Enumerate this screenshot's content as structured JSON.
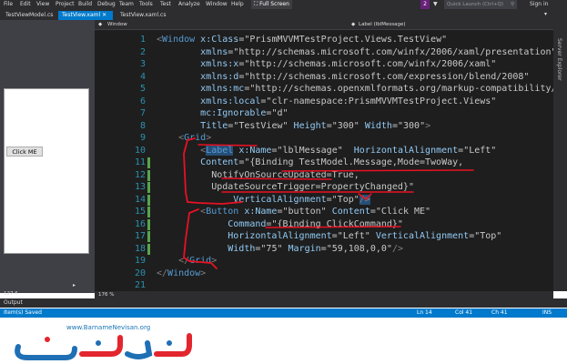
{
  "menubar": {
    "items": [
      "File",
      "Edit",
      "View",
      "Project",
      "Build",
      "Debug",
      "Team",
      "Tools",
      "Test",
      "Analyze",
      "Window",
      "Help"
    ],
    "fullscreen_label": "Full Screen",
    "notification_count": "2",
    "search_placeholder": "Quick Launch (Ctrl+Q)",
    "signin_label": "Sign in"
  },
  "tabs": [
    {
      "label": "TestViewModel.cs",
      "active": false
    },
    {
      "label": "TestView.xaml",
      "active": true
    },
    {
      "label": "TestView.xaml.cs",
      "active": false
    }
  ],
  "designer": {
    "button_label": "Click ME"
  },
  "editor_header": {
    "left": "Window",
    "right": "Label (lblMessage)"
  },
  "server_panel": {
    "label": "Server Explorer"
  },
  "code_lines": [
    {
      "num": "1",
      "marked": false,
      "tokens": [
        {
          "t": "<",
          "c": "d"
        },
        {
          "t": "Window",
          "c": "e"
        },
        {
          "t": " x:Class",
          "c": "a"
        },
        {
          "t": "=",
          "c": "b"
        },
        {
          "t": "\"PrismMVVMTestProject.Views.TestView\"",
          "c": "v"
        }
      ]
    },
    {
      "num": "2",
      "marked": false,
      "tokens": [
        {
          "t": "        xmlns",
          "c": "a"
        },
        {
          "t": "=",
          "c": "b"
        },
        {
          "t": "\"http://schemas.microsoft.com/winfx/2006/xaml/presentation\"",
          "c": "v"
        }
      ]
    },
    {
      "num": "3",
      "marked": false,
      "tokens": [
        {
          "t": "        xmlns:x",
          "c": "a"
        },
        {
          "t": "=",
          "c": "b"
        },
        {
          "t": "\"http://schemas.microsoft.com/winfx/2006/xaml\"",
          "c": "v"
        }
      ]
    },
    {
      "num": "4",
      "marked": false,
      "tokens": [
        {
          "t": "        xmlns:d",
          "c": "a"
        },
        {
          "t": "=",
          "c": "b"
        },
        {
          "t": "\"http://schemas.microsoft.com/expression/blend/2008\"",
          "c": "v"
        }
      ]
    },
    {
      "num": "5",
      "marked": false,
      "tokens": [
        {
          "t": "        xmlns:mc",
          "c": "a"
        },
        {
          "t": "=",
          "c": "b"
        },
        {
          "t": "\"http://schemas.openxmlformats.org/markup-compatibility/20",
          "c": "v"
        }
      ]
    },
    {
      "num": "6",
      "marked": false,
      "tokens": [
        {
          "t": "        xmlns:local",
          "c": "a"
        },
        {
          "t": "=",
          "c": "b"
        },
        {
          "t": "\"clr-namespace:PrismMVVMTestProject.Views\"",
          "c": "v"
        }
      ]
    },
    {
      "num": "7",
      "marked": false,
      "tokens": [
        {
          "t": "        mc:Ignorable",
          "c": "a"
        },
        {
          "t": "=",
          "c": "b"
        },
        {
          "t": "\"d\"",
          "c": "v"
        }
      ]
    },
    {
      "num": "8",
      "marked": false,
      "tokens": [
        {
          "t": "        Title",
          "c": "a"
        },
        {
          "t": "=",
          "c": "b"
        },
        {
          "t": "\"TestView\"",
          "c": "v"
        },
        {
          "t": " Height",
          "c": "a"
        },
        {
          "t": "=",
          "c": "b"
        },
        {
          "t": "\"300\"",
          "c": "v"
        },
        {
          "t": " Width",
          "c": "a"
        },
        {
          "t": "=",
          "c": "b"
        },
        {
          "t": "\"300\"",
          "c": "v"
        },
        {
          "t": ">",
          "c": "d"
        }
      ]
    },
    {
      "num": "9",
      "marked": false,
      "tokens": [
        {
          "t": "    <",
          "c": "d"
        },
        {
          "t": "Grid",
          "c": "e"
        },
        {
          "t": ">",
          "c": "d"
        }
      ]
    },
    {
      "num": "10",
      "marked": false,
      "tokens": [
        {
          "t": "        <",
          "c": "d"
        },
        {
          "t": "Label",
          "c": "e",
          "hl": true
        },
        {
          "t": " x:Name",
          "c": "a"
        },
        {
          "t": "=",
          "c": "b"
        },
        {
          "t": "\"lblMessage\"",
          "c": "v"
        },
        {
          "t": "  HorizontalAlignment",
          "c": "a"
        },
        {
          "t": "=",
          "c": "b"
        },
        {
          "t": "\"Left\"",
          "c": "v"
        }
      ]
    },
    {
      "num": "11",
      "marked": true,
      "tokens": [
        {
          "t": "        Content",
          "c": "a"
        },
        {
          "t": "=",
          "c": "b"
        },
        {
          "t": "\"{Binding TestModel.Message,Mode=TwoWay,",
          "c": "v"
        }
      ]
    },
    {
      "num": "12",
      "marked": true,
      "tokens": [
        {
          "t": "          NotifyOnSourceUpdated=True,",
          "c": "v"
        }
      ]
    },
    {
      "num": "13",
      "marked": true,
      "tokens": [
        {
          "t": "          UpdateSourceTrigger=PropertyChanged}\"",
          "c": "v"
        }
      ]
    },
    {
      "num": "14",
      "marked": true,
      "tokens": [
        {
          "t": "              VerticalAlignment",
          "c": "a"
        },
        {
          "t": "=",
          "c": "b"
        },
        {
          "t": "\"Top\"",
          "c": "v"
        },
        {
          "t": "/>",
          "c": "d",
          "hl": true
        }
      ]
    },
    {
      "num": "15",
      "marked": true,
      "tokens": [
        {
          "t": "        <",
          "c": "d"
        },
        {
          "t": "Button",
          "c": "e"
        },
        {
          "t": " x:Name",
          "c": "a"
        },
        {
          "t": "=",
          "c": "b"
        },
        {
          "t": "\"button\"",
          "c": "v"
        },
        {
          "t": " Content",
          "c": "a"
        },
        {
          "t": "=",
          "c": "b"
        },
        {
          "t": "\"Click ME\"",
          "c": "v"
        }
      ]
    },
    {
      "num": "16",
      "marked": true,
      "tokens": [
        {
          "t": "             Command",
          "c": "a"
        },
        {
          "t": "=",
          "c": "b"
        },
        {
          "t": "\"{Binding ClickCommand}\"",
          "c": "v"
        }
      ]
    },
    {
      "num": "17",
      "marked": true,
      "tokens": [
        {
          "t": "             HorizontalAlignment",
          "c": "a"
        },
        {
          "t": "=",
          "c": "b"
        },
        {
          "t": "\"Left\"",
          "c": "v"
        },
        {
          "t": " VerticalAlignment",
          "c": "a"
        },
        {
          "t": "=",
          "c": "b"
        },
        {
          "t": "\"Top\"",
          "c": "v"
        }
      ]
    },
    {
      "num": "18",
      "marked": true,
      "tokens": [
        {
          "t": "             Width",
          "c": "a"
        },
        {
          "t": "=",
          "c": "b"
        },
        {
          "t": "\"75\"",
          "c": "v"
        },
        {
          "t": " Margin",
          "c": "a"
        },
        {
          "t": "=",
          "c": "b"
        },
        {
          "t": "\"59,108,0,0\"",
          "c": "v"
        },
        {
          "t": "/>",
          "c": "d"
        }
      ]
    },
    {
      "num": "19",
      "marked": false,
      "tokens": [
        {
          "t": "    </",
          "c": "d"
        },
        {
          "t": "Grid",
          "c": "e"
        },
        {
          "t": ">",
          "c": "d"
        }
      ]
    },
    {
      "num": "20",
      "marked": false,
      "tokens": [
        {
          "t": "</",
          "c": "d"
        },
        {
          "t": "Window",
          "c": "e"
        },
        {
          "t": ">",
          "c": "d"
        }
      ]
    },
    {
      "num": "21",
      "marked": false,
      "tokens": []
    }
  ],
  "editor_status": {
    "left_zoom": "127.6",
    "zoom": "176 %"
  },
  "output_label": "Output",
  "statusbar": {
    "message": "Item(s) Saved",
    "line": "Ln 14",
    "col": "Col 41",
    "ch": "Ch 41",
    "mode": "INS"
  },
  "watermark": {
    "url": "www.BarnameNevisan.org",
    "logo_text": "برنامه نویسان"
  },
  "colors": {
    "accent": "#007acc",
    "editor_bg": "#1e1e1e",
    "annotation": "#e81123"
  }
}
